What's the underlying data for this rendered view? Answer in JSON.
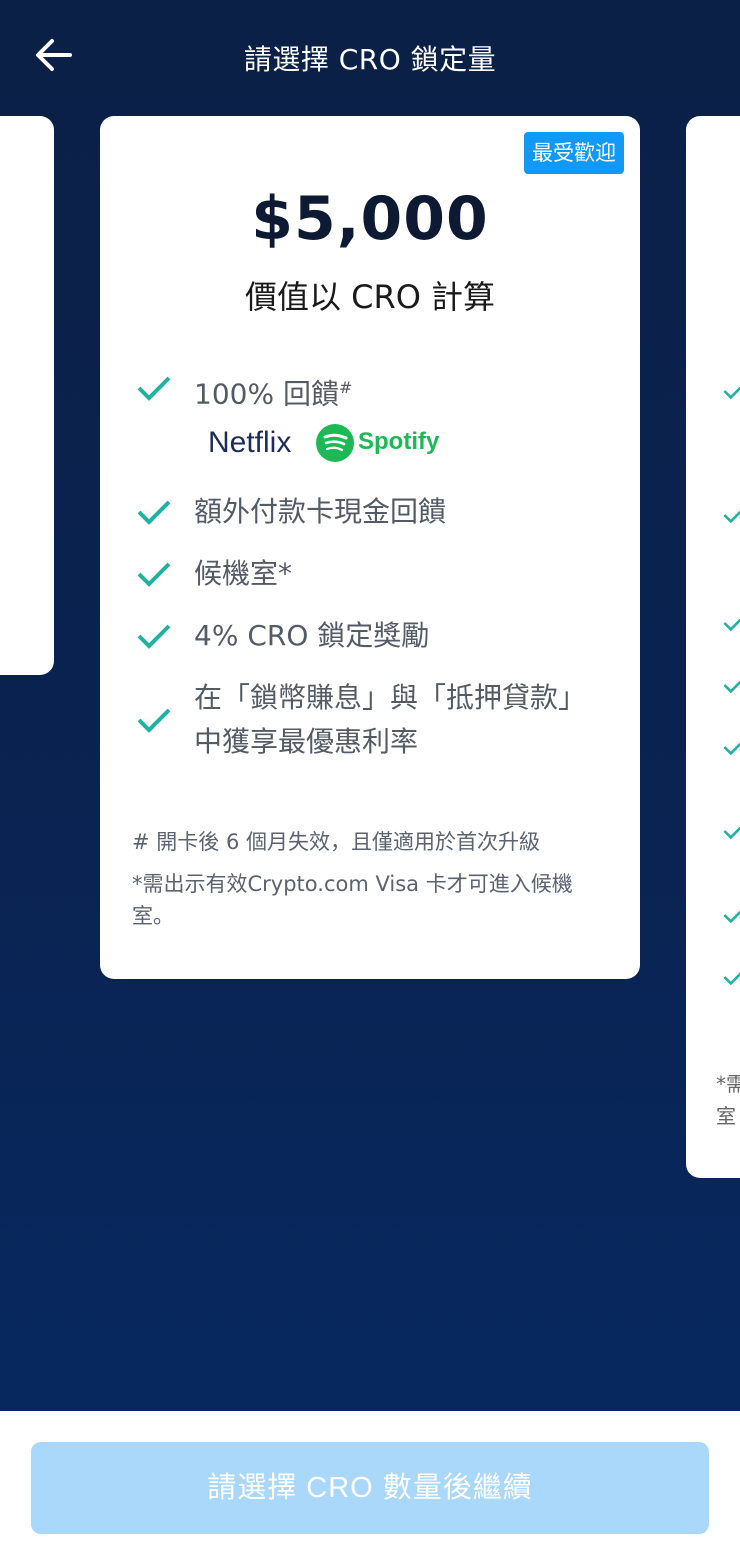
{
  "header": {
    "title": "請選擇 CRO 鎖定量"
  },
  "card": {
    "badge": "最受歡迎",
    "amount": "$5,000",
    "subtitle": "價值以 CRO 計算",
    "features": [
      {
        "text": "100% 回饋",
        "sup": "#"
      },
      {
        "text": "額外付款卡現金回饋"
      },
      {
        "text": "候機室*"
      },
      {
        "text": "4% CRO 鎖定獎勵"
      },
      {
        "line1": "在「鎖幣賺息」與「抵押貸款」",
        "line2": "中獲享最優惠利率"
      }
    ],
    "logos": {
      "netflix": "Netflix",
      "spotify": "Spotify"
    },
    "footnotes": {
      "note1": "# 開卡後 6 個月失效，且僅適用於首次升級",
      "note2_line1": "*需出示有效Crypto.com Visa 卡才可進入候機",
      "note2_line2": "室。"
    }
  },
  "right_peek": {
    "note_line1": "*需",
    "note_line2": "室"
  },
  "footer": {
    "continue_label": "請選擇 CRO 數量後繼續"
  },
  "colors": {
    "accent": "#1199fa",
    "check": "#20b2a0",
    "button_disabled": "#aad8fb"
  }
}
